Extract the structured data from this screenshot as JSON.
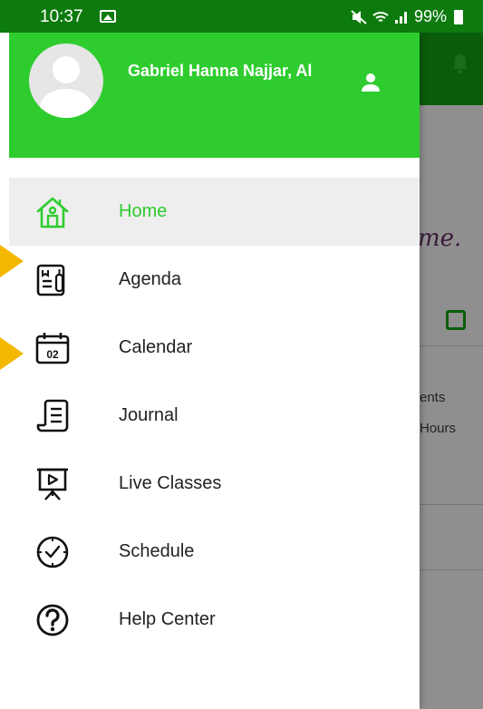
{
  "status_bar": {
    "time": "10:37",
    "battery": "99%"
  },
  "background_app": {
    "partial_text_me": "me.",
    "partial_text_ents": "ents",
    "partial_text_hours": "Hours"
  },
  "drawer": {
    "user_name": "Gabriel Hanna Najjar, Al",
    "menu": [
      {
        "label": "Home",
        "icon": "home-icon",
        "active": true
      },
      {
        "label": "Agenda",
        "icon": "agenda-icon"
      },
      {
        "label": "Calendar",
        "icon": "calendar-icon",
        "icon_text": "02"
      },
      {
        "label": "Journal",
        "icon": "journal-icon"
      },
      {
        "label": "Live Classes",
        "icon": "live-classes-icon"
      },
      {
        "label": "Schedule",
        "icon": "schedule-icon"
      },
      {
        "label": "Help Center",
        "icon": "help-center-icon"
      }
    ]
  },
  "colors": {
    "header_green": "#2ecc2e",
    "status_green": "#0d7a0d",
    "arrow_yellow": "#f5b800",
    "active_bg": "#eeeeee"
  }
}
